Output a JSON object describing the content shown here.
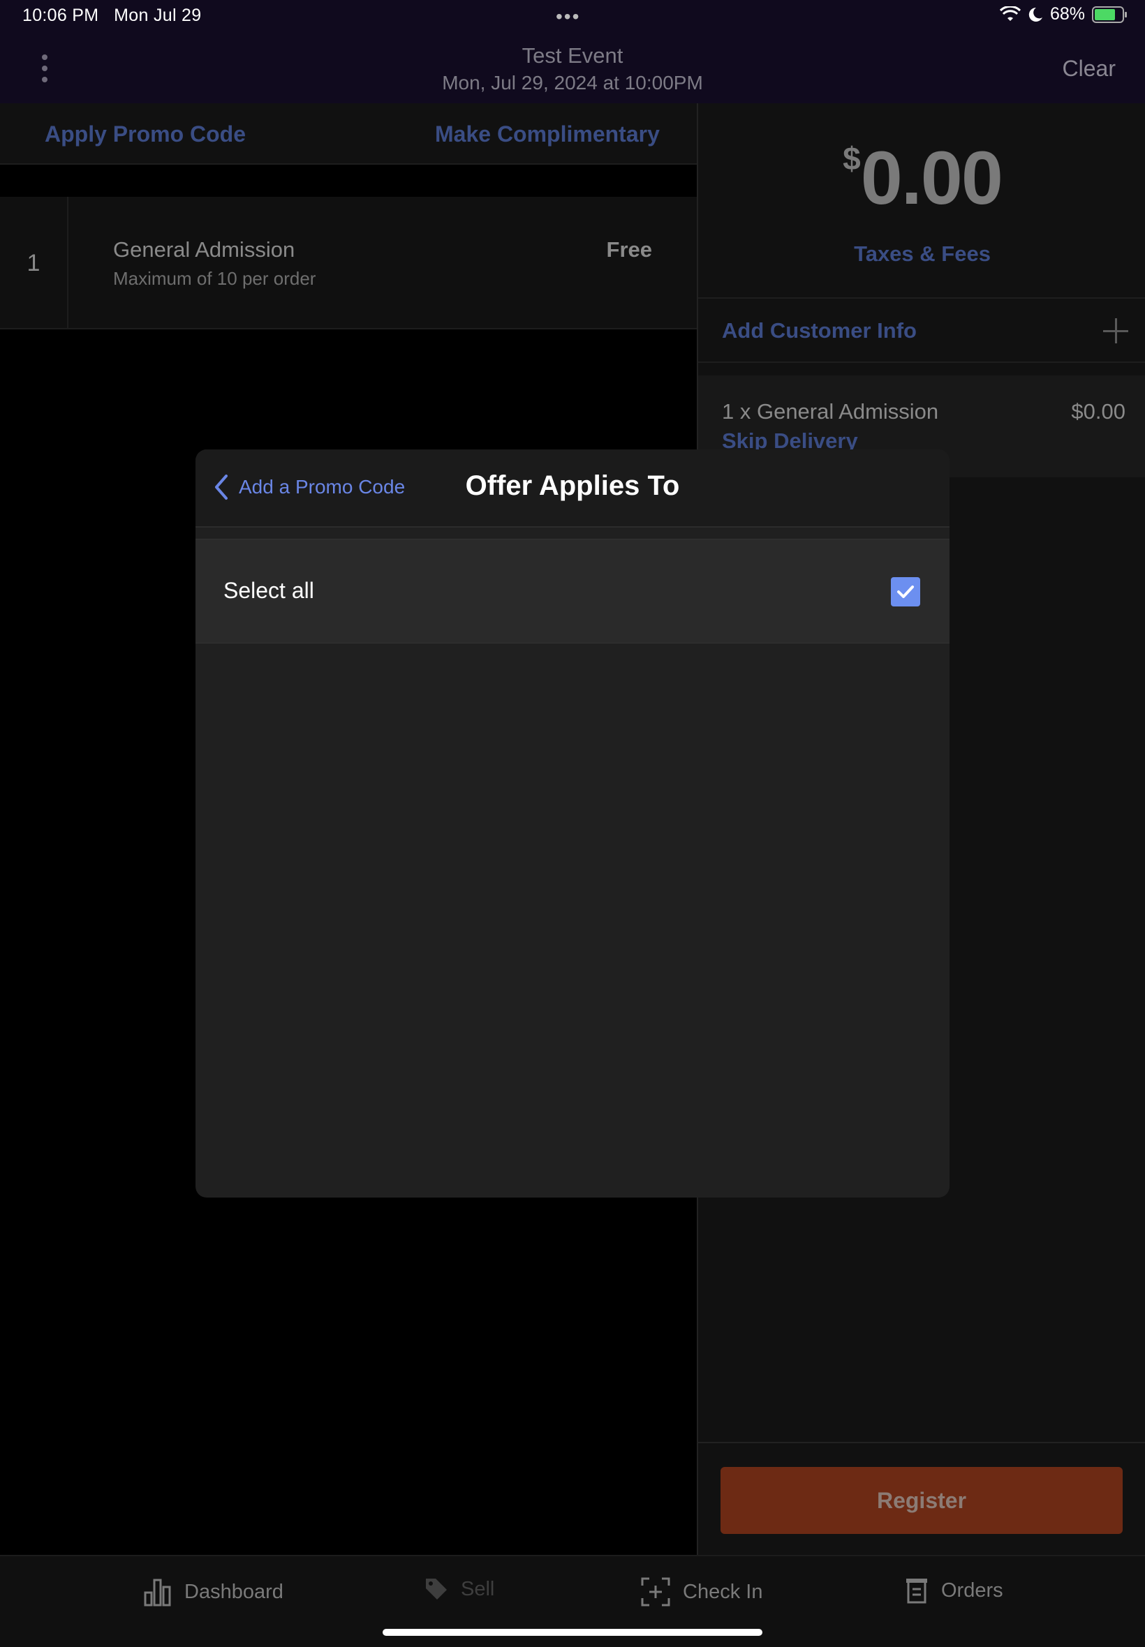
{
  "status_bar": {
    "time": "10:06 PM",
    "date": "Mon Jul 29",
    "battery": "68%"
  },
  "header": {
    "title": "Test Event",
    "subtitle": "Mon, Jul 29, 2024 at 10:00PM",
    "clear_label": "Clear"
  },
  "actions": {
    "apply_promo": "Apply Promo Code",
    "make_complimentary": "Make Complimentary"
  },
  "ticket": {
    "quantity": "1",
    "name": "General Admission",
    "limit": "Maximum of 10 per order",
    "price": "Free"
  },
  "order": {
    "currency": "$",
    "total": "0.00",
    "taxes_label": "Taxes & Fees",
    "customer_label": "Add Customer Info",
    "item_line": "1 x General Admission",
    "item_price": "$0.00",
    "delivery_label": "Skip Delivery",
    "register_label": "Register"
  },
  "modal": {
    "back_label": "Add a Promo Code",
    "title": "Offer Applies To",
    "select_all_label": "Select all",
    "select_all_checked": true
  },
  "tabs": [
    {
      "label": "Dashboard",
      "icon": "bar-chart-icon"
    },
    {
      "label": "Sell",
      "icon": "tag-icon"
    },
    {
      "label": "Check In",
      "icon": "scan-icon"
    },
    {
      "label": "Orders",
      "icon": "receipt-icon"
    }
  ],
  "colors": {
    "link": "#3a4d84",
    "modal_accent": "#6a86e6",
    "register": "#6d2a14"
  }
}
